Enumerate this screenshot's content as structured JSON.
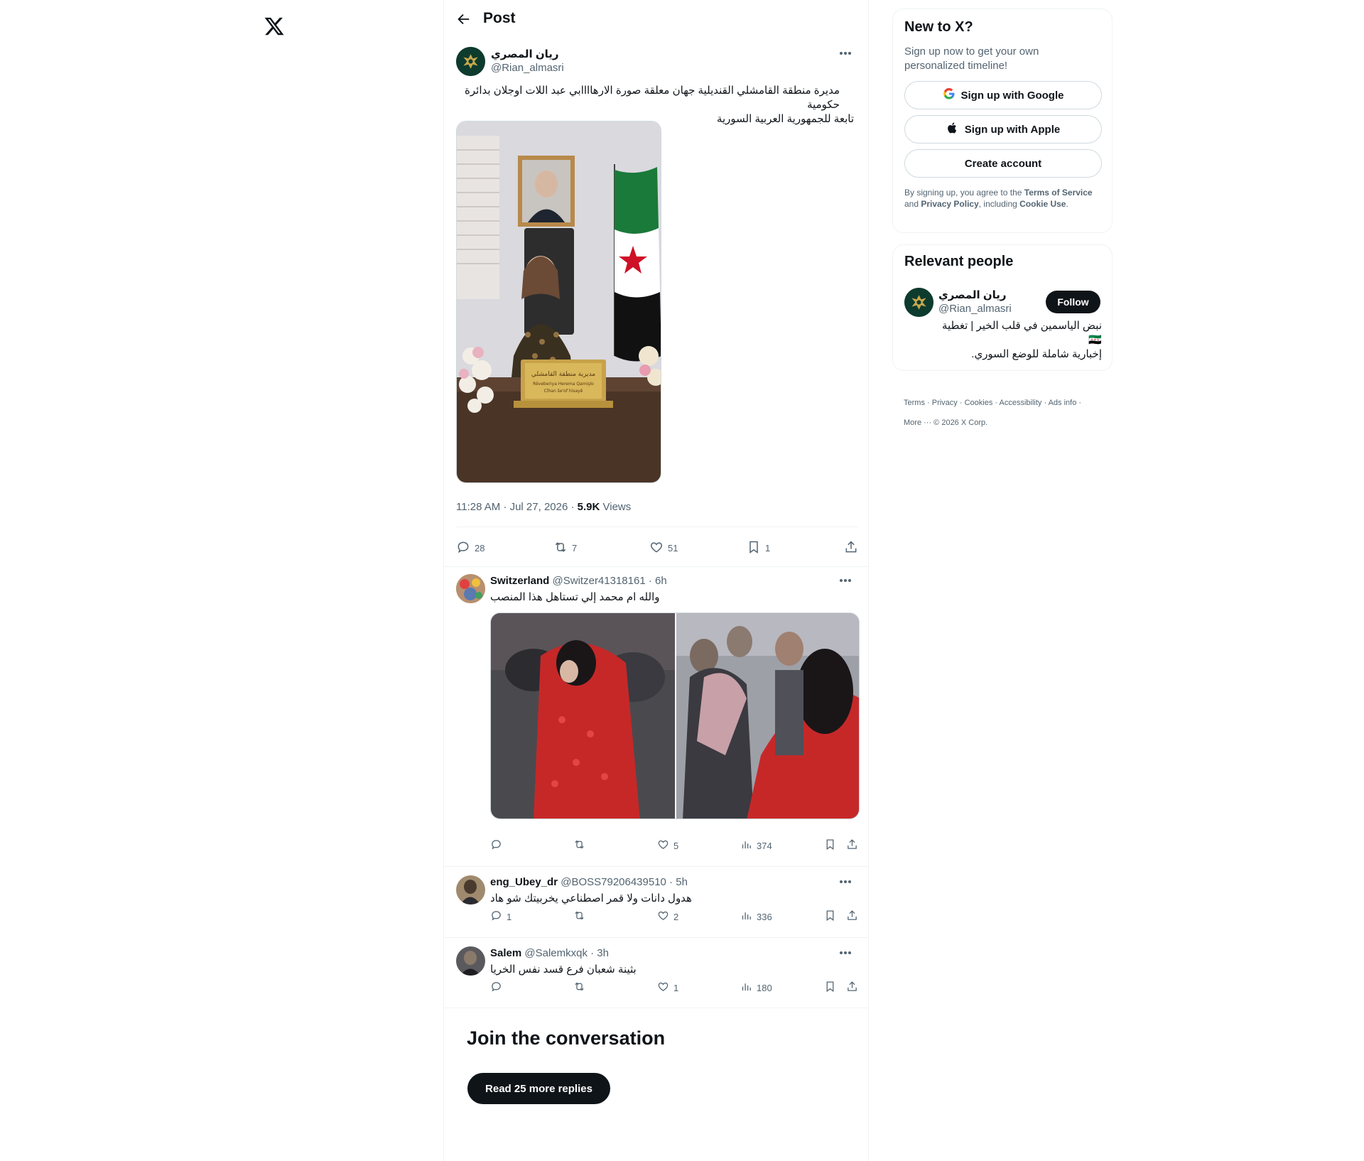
{
  "header": {
    "title": "Post"
  },
  "post": {
    "author_name": "ريان المصري",
    "author_handle": "@Rian_almasri",
    "text_line1": "مديرة منطقة القامشلي القنديلية جهان  معلقة صورة الارهاااابي عبد اللات اوجلان بدائرة حكومية",
    "text_line2": "تابعة للجمهورية العربية السورية",
    "time": "11:28 AM · Jul 27, 2026 · ",
    "views_count": "5.9K",
    "views_label": " Views",
    "stats": {
      "replies": "28",
      "reposts": "7",
      "likes": "51",
      "bookmarks": "1"
    },
    "image": {
      "nameplate_line1": "مديرية منطقة القامشلي",
      "nameplate_line2": "Rêveberiya Herema Qamişlo",
      "nameplate_line3": "Cîhan ŝe'of hisayê"
    }
  },
  "replies": [
    {
      "name": "Switzerland",
      "handle": "@Switzer41318161 · 6h",
      "text": "والله ام محمد إلي تستاهل هذا المنصب",
      "replies": "",
      "likes": "5",
      "views": "374"
    },
    {
      "name": "eng_Ubey_dr",
      "handle": "@BOSS79206439510 · 5h",
      "text": "هدول دانات ولا قمر اصطناعي يخربيتك شو هاد",
      "replies": "1",
      "likes": "2",
      "views": "336"
    },
    {
      "name": "Salem",
      "handle": "@Salemkxqk · 3h",
      "text": "بثينة شعبان فرع قسد نفس الخريا",
      "replies": "",
      "likes": "1",
      "views": "180"
    }
  ],
  "join": {
    "title": "Join the conversation",
    "button": "Read 25 more replies"
  },
  "signup": {
    "title": "New to X?",
    "subtitle": "Sign up now to get your own personalized timeline!",
    "google": "Sign up with Google",
    "apple": "Sign up with Apple",
    "create": "Create account",
    "legal_pre": "By signing up, you agree to the ",
    "terms": "Terms of Service",
    "legal_and": " and ",
    "privacy": "Privacy Policy",
    "legal_incl": ", including ",
    "cookie": "Cookie Use",
    "legal_end": "."
  },
  "relevant": {
    "title": "Relevant people",
    "name": "ريان المصري",
    "handle": "@Rian_almasri",
    "follow": "Follow",
    "bio_line1": "نبض الياسمين في قلب الخير | تغطية 🇸🇾",
    "bio_line2": "إخبارية شاملة للوضع السوري."
  },
  "footer": {
    "terms": "Terms",
    "privacy": "Privacy",
    "cookies": "Cookies",
    "accessibility": "Accessibility",
    "ads": "Ads info",
    "more": "More ···",
    "copyright": "© 2026 X Corp."
  },
  "colors": {
    "text": "#0f1419",
    "muted": "#536471",
    "border": "#eff3f4",
    "avatar_bg": "#0d3b2e",
    "flag_green": "#1a7a3a",
    "flag_red": "#ce1126"
  }
}
